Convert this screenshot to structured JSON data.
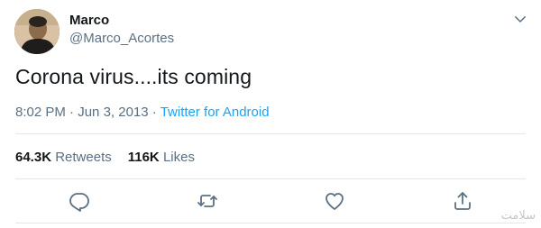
{
  "user": {
    "name": "Marco",
    "handle": "@Marco_Acortes"
  },
  "tweet": {
    "text": "Corona virus....its coming",
    "time": "8:02 PM",
    "separator": " · ",
    "date": "Jun 3, 2013",
    "source": "Twitter for Android"
  },
  "stats": {
    "retweets_count": "64.3K",
    "retweets_label": "Retweets",
    "likes_count": "116K",
    "likes_label": "Likes"
  },
  "icons": {
    "more": "chevron-down-icon",
    "reply": "reply-icon",
    "retweet": "retweet-icon",
    "like": "heart-icon",
    "share": "share-icon"
  },
  "colors": {
    "text": "#14171a",
    "secondary": "#5b7083",
    "link": "#1da1f2",
    "divider": "#e1e8ed"
  },
  "watermark": "سلامت"
}
